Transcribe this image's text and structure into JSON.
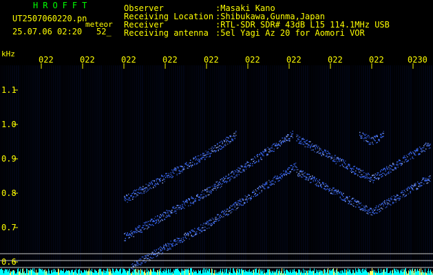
{
  "header": {
    "app_title": "HROFFT",
    "file_name": "UT2507060220.pn",
    "file_type": "meteor",
    "datetime": "25.07.06 02:20",
    "count": "52_"
  },
  "meta": [
    {
      "label": "Observer",
      "value": ":Masaki Kano"
    },
    {
      "label": "Receiving Location",
      "value": ":Shibukawa,Gunma,Japan"
    },
    {
      "label": "Receiver",
      "value": ":RTL-SDR SDR# 43dB L15 114.1MHz USB"
    },
    {
      "label": "Receiving antenna",
      "value": ":5el Yagi Az 20 for Aomori VOR"
    }
  ],
  "axes": {
    "y_unit": "kHz",
    "x_ticks": [
      "022",
      "022",
      "022",
      "022",
      "022",
      "022",
      "022",
      "022",
      "022",
      "0230"
    ],
    "y_ticks": [
      "1.1",
      "1.0",
      "0.9",
      "0.8",
      "0.7",
      "0.6"
    ]
  },
  "colors": {
    "label": "#ffff00",
    "title": "#00ff00",
    "trace": "#3a6bff",
    "trace_bright": "#9fb8ff",
    "ref_line": "#c8c8c8",
    "noise": "#00ffff"
  }
}
